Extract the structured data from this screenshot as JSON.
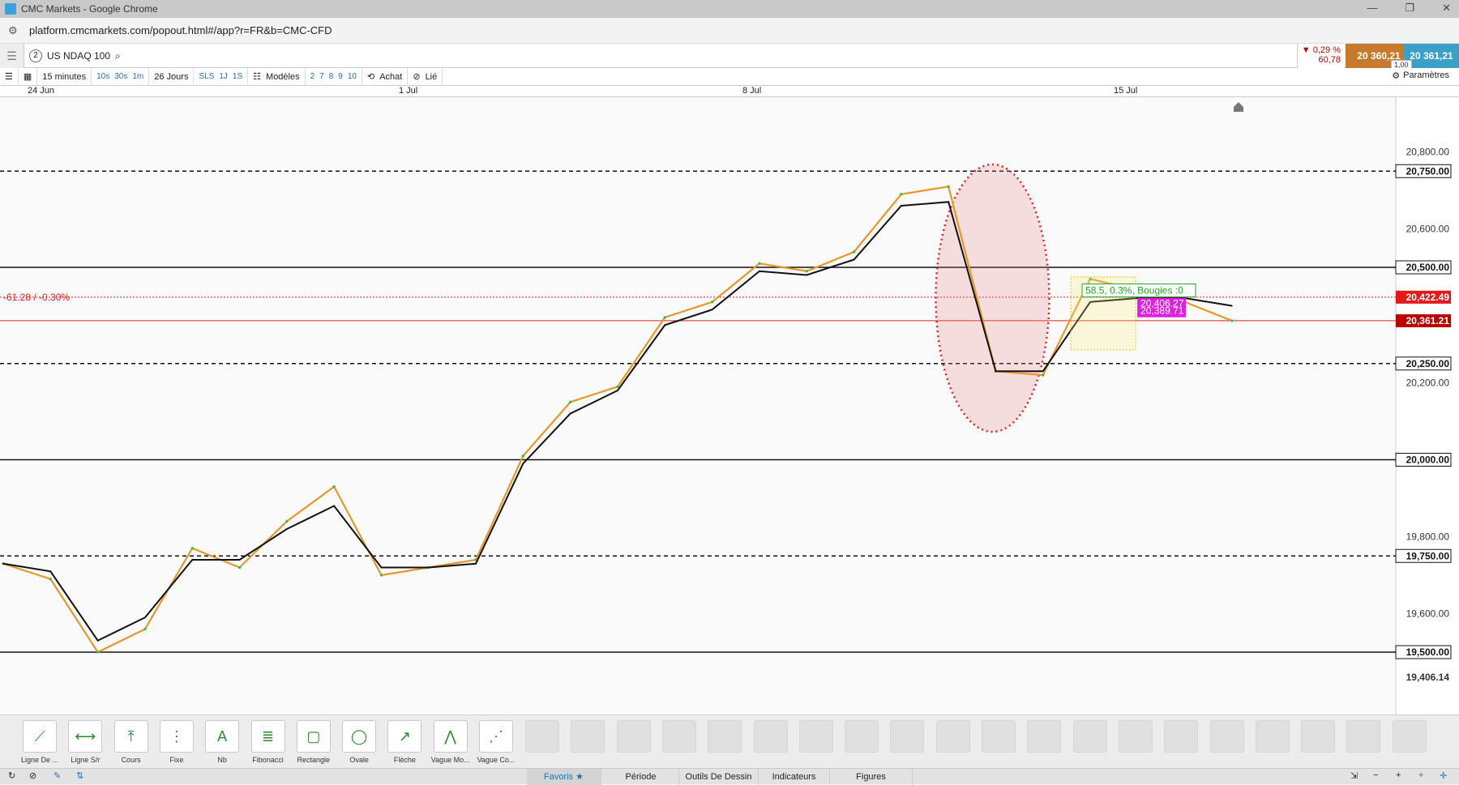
{
  "window": {
    "title": "CMC Markets - Google Chrome",
    "controls": [
      "—",
      "❐",
      "✕"
    ]
  },
  "browser": {
    "url": "platform.cmcmarkets.com/popout.html#/app?r=FR&b=CMC-CFD"
  },
  "instrument": {
    "index": "2",
    "name": "US NDAQ 100",
    "change_pct": "▼ 0,29 %",
    "change_abs": "60,78",
    "sell": "20 360,21",
    "buy": "20 361,21",
    "spread": "1,00"
  },
  "toolbar": {
    "interval": "15 minutes",
    "quick_intervals": [
      "10s",
      "30s",
      "1m"
    ],
    "range": "26 Jours",
    "sls": "SLS",
    "quick_ranges": [
      "1J",
      "1S"
    ],
    "templates": "Modèles",
    "counts": [
      "2",
      "7",
      "8",
      "9",
      "10"
    ],
    "side": "Achat",
    "link": "Lié",
    "params": "Paramètres"
  },
  "dates": [
    "24 Jun",
    "1 Jul",
    "8 Jul",
    "15 Jul"
  ],
  "chart_data": {
    "type": "line",
    "title": "",
    "xlabel": "",
    "ylabel": "",
    "ylim": [
      19380,
      20900
    ],
    "y_ticks": [
      "20,800.00",
      "20,600.00",
      "20,200.00",
      "19,800.00",
      "19,600.00"
    ],
    "horizontal_levels": [
      {
        "value": 20750,
        "label": "20,750.00",
        "style": "dashed"
      },
      {
        "value": 20500,
        "label": "20,500.00",
        "style": "solid"
      },
      {
        "value": 20250,
        "label": "20,250.00",
        "style": "dashed"
      },
      {
        "value": 20000,
        "label": "20,000.00",
        "style": "solid"
      },
      {
        "value": 19750,
        "label": "19,750.00",
        "style": "dashed"
      },
      {
        "value": 19500,
        "label": "19,500.00",
        "style": "solid"
      }
    ],
    "ref_line": {
      "value": 20422.49,
      "label": "20,422.49",
      "note": "-61.28 / -0.30%"
    },
    "current_price": {
      "value": 20361.21,
      "label": "20,361.21"
    },
    "low_label": "19,406.14",
    "overlay_labels": {
      "measure": "58.5, 0.3%, Bougies :0",
      "high": "20,406.27",
      "low": "20,389.71"
    },
    "series": [
      {
        "name": "",
        "color": "#e8962a",
        "points": [
          [
            "24 Jun",
            19730
          ],
          [
            "25 Jun",
            19690
          ],
          [
            "26 Jun",
            19500
          ],
          [
            "27 Jun",
            19560
          ],
          [
            "28 Jun",
            19770
          ],
          [
            "29 Jun",
            19720
          ],
          [
            "30 Jun",
            19840
          ],
          [
            "1 Jul",
            19930
          ],
          [
            "2 Jul",
            19700
          ],
          [
            "3 Jul",
            19720
          ],
          [
            "4 Jul",
            19740
          ],
          [
            "5 Jul",
            20010
          ],
          [
            "6 Jul",
            20150
          ],
          [
            "7 Jul",
            20190
          ],
          [
            "8 Jul",
            20370
          ],
          [
            "9 Jul",
            20410
          ],
          [
            "10 Jul",
            20510
          ],
          [
            "11 Jul",
            20490
          ],
          [
            "12 Jul",
            20540
          ],
          [
            "13 Jul",
            20690
          ],
          [
            "14 Jul",
            20710
          ],
          [
            "15 Jul",
            20230
          ],
          [
            "16 Jul",
            20220
          ],
          [
            "17 Jul",
            20470
          ],
          [
            "18 Jul",
            20440
          ],
          [
            "19 Jul",
            20410
          ],
          [
            "20 Jul",
            20361
          ]
        ]
      },
      {
        "name": "",
        "color": "#111111",
        "points": [
          [
            "24 Jun",
            19730
          ],
          [
            "25 Jun",
            19710
          ],
          [
            "26 Jun",
            19530
          ],
          [
            "27 Jun",
            19590
          ],
          [
            "28 Jun",
            19740
          ],
          [
            "29 Jun",
            19740
          ],
          [
            "30 Jun",
            19820
          ],
          [
            "1 Jul",
            19880
          ],
          [
            "2 Jul",
            19720
          ],
          [
            "3 Jul",
            19720
          ],
          [
            "4 Jul",
            19730
          ],
          [
            "5 Jul",
            19990
          ],
          [
            "6 Jul",
            20120
          ],
          [
            "7 Jul",
            20180
          ],
          [
            "8 Jul",
            20350
          ],
          [
            "9 Jul",
            20390
          ],
          [
            "10 Jul",
            20490
          ],
          [
            "11 Jul",
            20480
          ],
          [
            "12 Jul",
            20520
          ],
          [
            "13 Jul",
            20660
          ],
          [
            "14 Jul",
            20670
          ],
          [
            "15 Jul",
            20230
          ],
          [
            "16 Jul",
            20230
          ],
          [
            "17 Jul",
            20410
          ],
          [
            "18 Jul",
            20420
          ],
          [
            "19 Jul",
            20420
          ],
          [
            "20 Jul",
            20400
          ]
        ]
      }
    ],
    "annotation": "red dotted ellipse highlighting the mid-July drop"
  },
  "tools": [
    {
      "label": "Ligne De ...",
      "icon": "line-icon"
    },
    {
      "label": "Ligne S/r",
      "icon": "sr-line-icon"
    },
    {
      "label": "Cours",
      "icon": "price-icon"
    },
    {
      "label": "Fixe",
      "icon": "fixed-icon"
    },
    {
      "label": "Nb",
      "icon": "text-icon"
    },
    {
      "label": "Fibonacci",
      "icon": "fibonacci-icon"
    },
    {
      "label": "Rectangle",
      "icon": "rectangle-icon"
    },
    {
      "label": "Ovale",
      "icon": "oval-icon"
    },
    {
      "label": "Flèche",
      "icon": "arrow-icon"
    },
    {
      "label": "Vague Mo...",
      "icon": "wave-icon"
    },
    {
      "label": "Vague Co...",
      "icon": "wave-co-icon"
    }
  ],
  "bottom_tabs": [
    "Favoris",
    "Période",
    "Outils De Dessin",
    "Indicateurs",
    "Figures"
  ],
  "colors": {
    "sell": "#c77a2c",
    "buy": "#3aa0c8",
    "down": "#cc0000",
    "green": "#22aa22"
  }
}
